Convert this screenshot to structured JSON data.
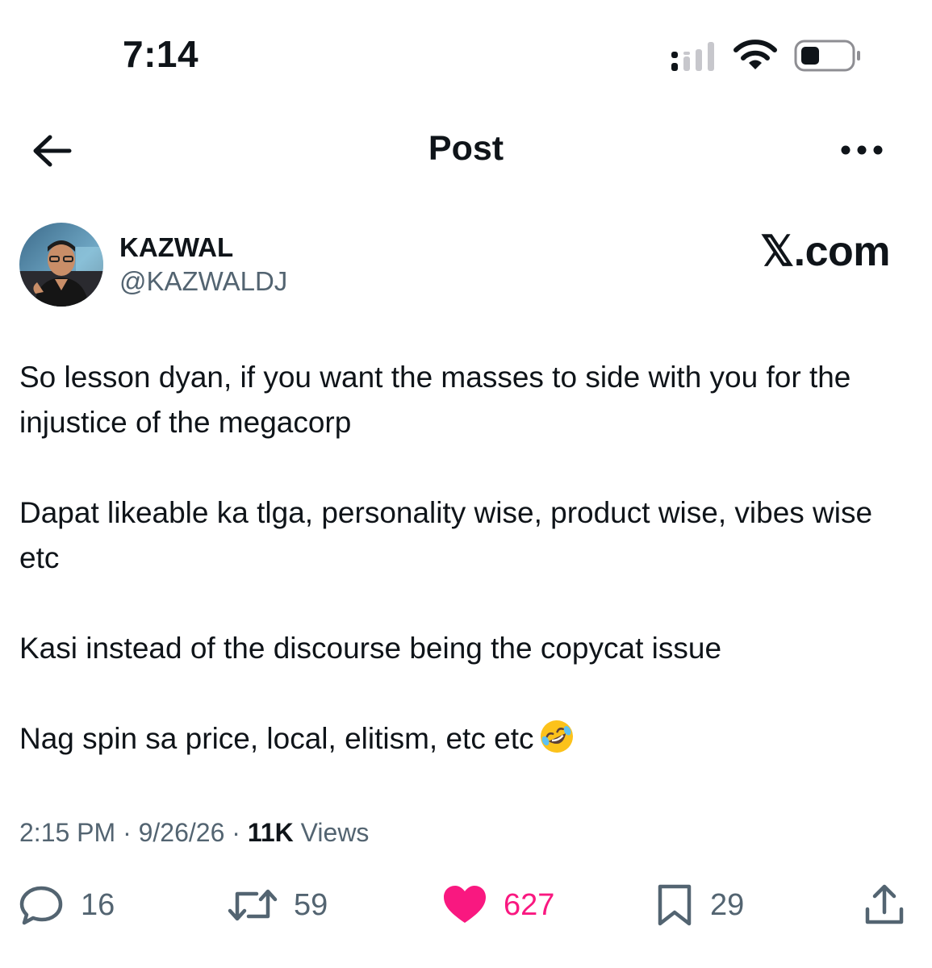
{
  "status_bar": {
    "time": "7:14"
  },
  "nav": {
    "title": "Post",
    "back_icon": "arrow-left-icon",
    "more_icon": "ellipsis-icon"
  },
  "author": {
    "display_name": "KAZWAL",
    "handle": "@KAZWALDJ"
  },
  "watermark": "𝕏.com",
  "post": {
    "paragraphs": [
      "So lesson dyan, if you want the masses to side with you for the injustice of the megacorp",
      "Dapat likeable ka tlga, personality wise, product wise, vibes wise etc",
      "Kasi instead of the discourse being the copycat issue",
      "Nag spin sa price, local, elitism, etc etc"
    ],
    "emoji": "🤣"
  },
  "meta": {
    "time": "2:15 PM",
    "date": "9/26/26",
    "views_count": "11K",
    "views_label": "Views",
    "separator": "·"
  },
  "actions": {
    "replies": "16",
    "reposts": "59",
    "likes": "627",
    "bookmarks": "29"
  },
  "colors": {
    "text": "#0f1419",
    "secondary": "#536471",
    "like": "#f91880"
  }
}
